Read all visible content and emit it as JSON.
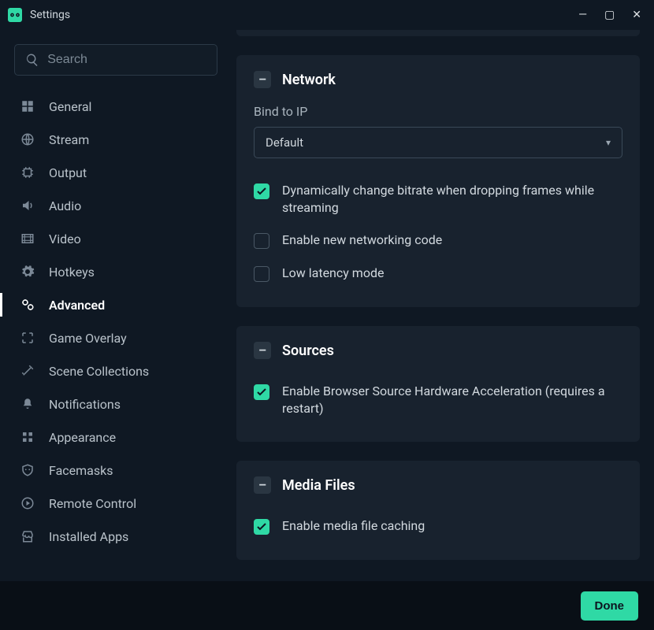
{
  "window": {
    "title": "Settings"
  },
  "search": {
    "placeholder": "Search"
  },
  "sidebar": {
    "items": [
      {
        "label": "General"
      },
      {
        "label": "Stream"
      },
      {
        "label": "Output"
      },
      {
        "label": "Audio"
      },
      {
        "label": "Video"
      },
      {
        "label": "Hotkeys"
      },
      {
        "label": "Advanced"
      },
      {
        "label": "Game Overlay"
      },
      {
        "label": "Scene Collections"
      },
      {
        "label": "Notifications"
      },
      {
        "label": "Appearance"
      },
      {
        "label": "Facemasks"
      },
      {
        "label": "Remote Control"
      },
      {
        "label": "Installed Apps"
      }
    ]
  },
  "panels": {
    "network": {
      "title": "Network",
      "bind_label": "Bind to IP",
      "bind_value": "Default",
      "opt_dynamic": "Dynamically change bitrate when dropping frames while streaming",
      "opt_newnet": "Enable new networking code",
      "opt_lowlat": "Low latency mode"
    },
    "sources": {
      "title": "Sources",
      "opt_hwaccel": "Enable Browser Source Hardware Acceleration (requires a restart)"
    },
    "media": {
      "title": "Media Files",
      "opt_cache": "Enable media file caching"
    }
  },
  "footer": {
    "done": "Done"
  },
  "collapse_glyph": "–"
}
